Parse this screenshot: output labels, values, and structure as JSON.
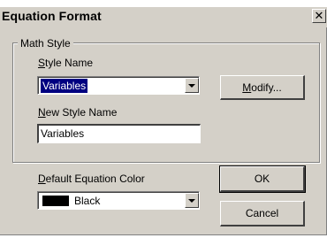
{
  "window": {
    "title": "Equation Format"
  },
  "math_style": {
    "group_label": "Math Style",
    "style_name_label": "Style Name",
    "style_name_mnemonic": "S",
    "style_name_rest": "tyle Name",
    "style_name_value": "Variables",
    "modify_label": "Modify...",
    "modify_mnemonic": "M",
    "modify_rest": "odify...",
    "new_style_label": "New Style Name",
    "new_style_mnemonic": "N",
    "new_style_rest": "ew Style Name",
    "new_style_value": "Variables"
  },
  "equation_color": {
    "label": "Default Equation Color",
    "mnemonic": "D",
    "rest": "efault Equation Color",
    "value": "Black",
    "swatch_color": "#000000"
  },
  "buttons": {
    "ok": "OK",
    "cancel": "Cancel"
  }
}
